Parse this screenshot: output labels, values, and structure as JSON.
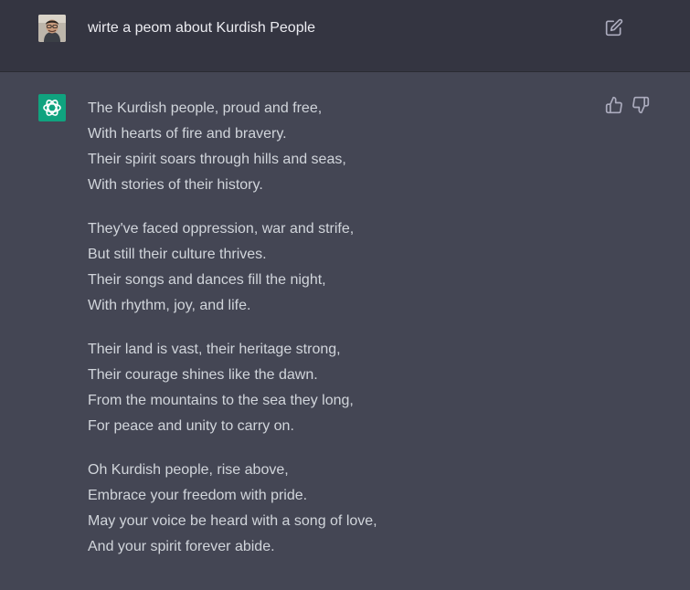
{
  "user_message": {
    "text": "wirte a peom about Kurdish People"
  },
  "assistant_message": {
    "stanzas": [
      [
        "The Kurdish people, proud and free,",
        "With hearts of fire and bravery.",
        "Their spirit soars through hills and seas,",
        "With stories of their history."
      ],
      [
        "They've faced oppression, war and strife,",
        "But still their culture thrives.",
        "Their songs and dances fill the night,",
        "With rhythm, joy, and life."
      ],
      [
        "Their land is vast, their heritage strong,",
        "Their courage shines like the dawn.",
        "From the mountains to the sea they long,",
        "For peace and unity to carry on."
      ],
      [
        "Oh Kurdish people, rise above,",
        "Embrace your freedom with pride.",
        "May your voice be heard with a song of love,",
        "And your spirit forever abide."
      ]
    ]
  },
  "icons": {
    "user_avatar": "user-avatar",
    "assistant_logo": "openai-logo-icon",
    "edit": "edit-icon",
    "thumbs_up": "thumbs-up-icon",
    "thumbs_down": "thumbs-down-icon"
  },
  "colors": {
    "user_row_bg": "#343541",
    "assistant_row_bg": "#444654",
    "assistant_avatar_bg": "#10a37f",
    "text": "#d1d5db",
    "icon": "#acacbe"
  }
}
